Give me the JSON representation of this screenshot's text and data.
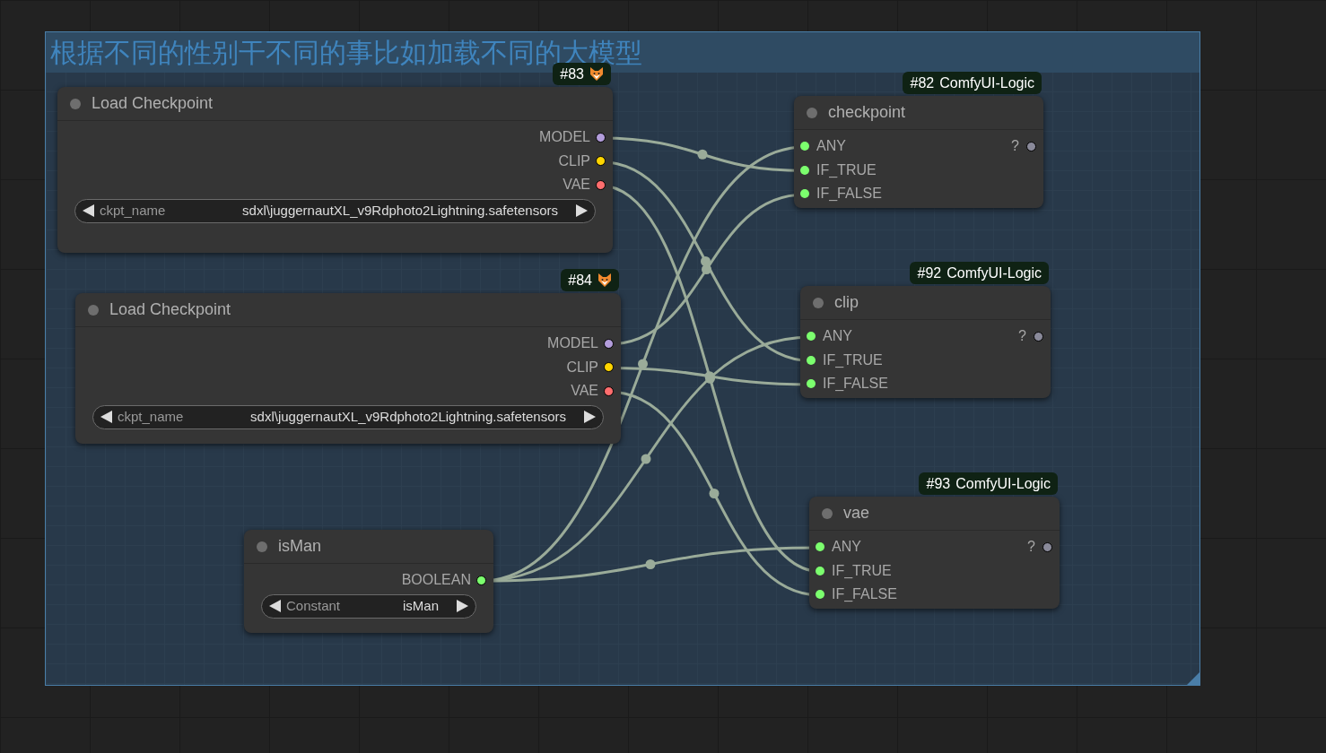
{
  "group": {
    "title": "根据不同的性别干不同的事比如加载不同的大模型"
  },
  "nodes": [
    {
      "kind": "loader",
      "badge": {
        "id": "#83",
        "fox": true
      },
      "title": "Load Checkpoint",
      "outputs": [
        {
          "label": "MODEL",
          "color": "#b39ddb"
        },
        {
          "label": "CLIP",
          "color": "#ffd500"
        },
        {
          "label": "VAE",
          "color": "#ff6e6e"
        }
      ],
      "widget": {
        "label": "ckpt_name",
        "value": "sdxl\\juggernautXL_v9Rdphoto2Lightning.safetensors"
      }
    },
    {
      "kind": "loader",
      "badge": {
        "id": "#84",
        "fox": true
      },
      "title": "Load Checkpoint",
      "outputs": [
        {
          "label": "MODEL",
          "color": "#b39ddb"
        },
        {
          "label": "CLIP",
          "color": "#ffd500"
        },
        {
          "label": "VAE",
          "color": "#ff6e6e"
        }
      ],
      "widget": {
        "label": "ckpt_name",
        "value": "sdxl\\juggernautXL_v9Rdphoto2Lightning.safetensors"
      }
    },
    {
      "kind": "loader",
      "title": "isMan",
      "outputs": [
        {
          "label": "BOOLEAN",
          "color": "#7cff6e"
        }
      ],
      "widget": {
        "label": "Constant",
        "value": "isMan"
      }
    },
    {
      "kind": "logic",
      "badge": {
        "id": "#82",
        "source": "ComfyUI-Logic"
      },
      "title": "checkpoint",
      "inputs": [
        "ANY",
        "IF_TRUE",
        "IF_FALSE"
      ],
      "output": "?"
    },
    {
      "kind": "logic",
      "badge": {
        "id": "#92",
        "source": "ComfyUI-Logic"
      },
      "title": "clip",
      "inputs": [
        "ANY",
        "IF_TRUE",
        "IF_FALSE"
      ],
      "output": "?"
    },
    {
      "kind": "logic",
      "badge": {
        "id": "#93",
        "source": "ComfyUI-Logic"
      },
      "title": "vae",
      "inputs": [
        "ANY",
        "IF_TRUE",
        "IF_FALSE"
      ],
      "output": "?"
    }
  ]
}
